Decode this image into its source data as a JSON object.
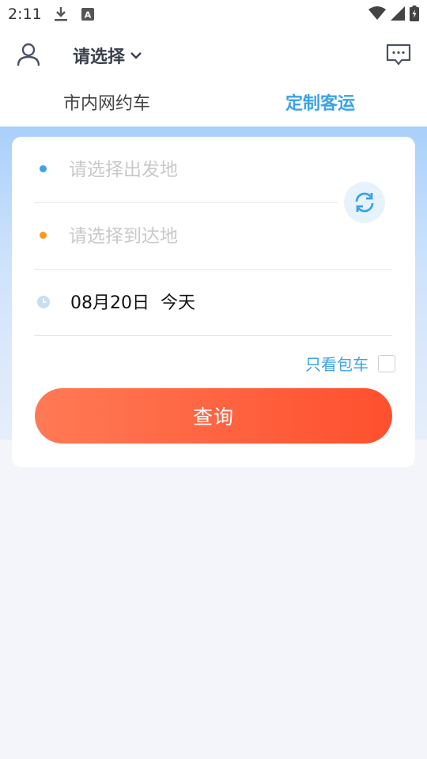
{
  "status_bar": {
    "time": "2:11",
    "a_badge": "A"
  },
  "header": {
    "city_label": "请选择",
    "tabs": [
      {
        "label": "市内网约车",
        "active": false
      },
      {
        "label": "定制客运",
        "active": true
      }
    ]
  },
  "form": {
    "from_placeholder": "请选择出发地",
    "to_placeholder": "请选择到达地",
    "date": "08月20日",
    "day": "今天",
    "charter_only_label": "只看包车",
    "query_label": "查询"
  },
  "colors": {
    "accent_blue": "#3aa3ea",
    "accent_orange": "#ff9a16",
    "button_gradient_start": "#ff7a55",
    "button_gradient_end": "#ff4f2e"
  }
}
